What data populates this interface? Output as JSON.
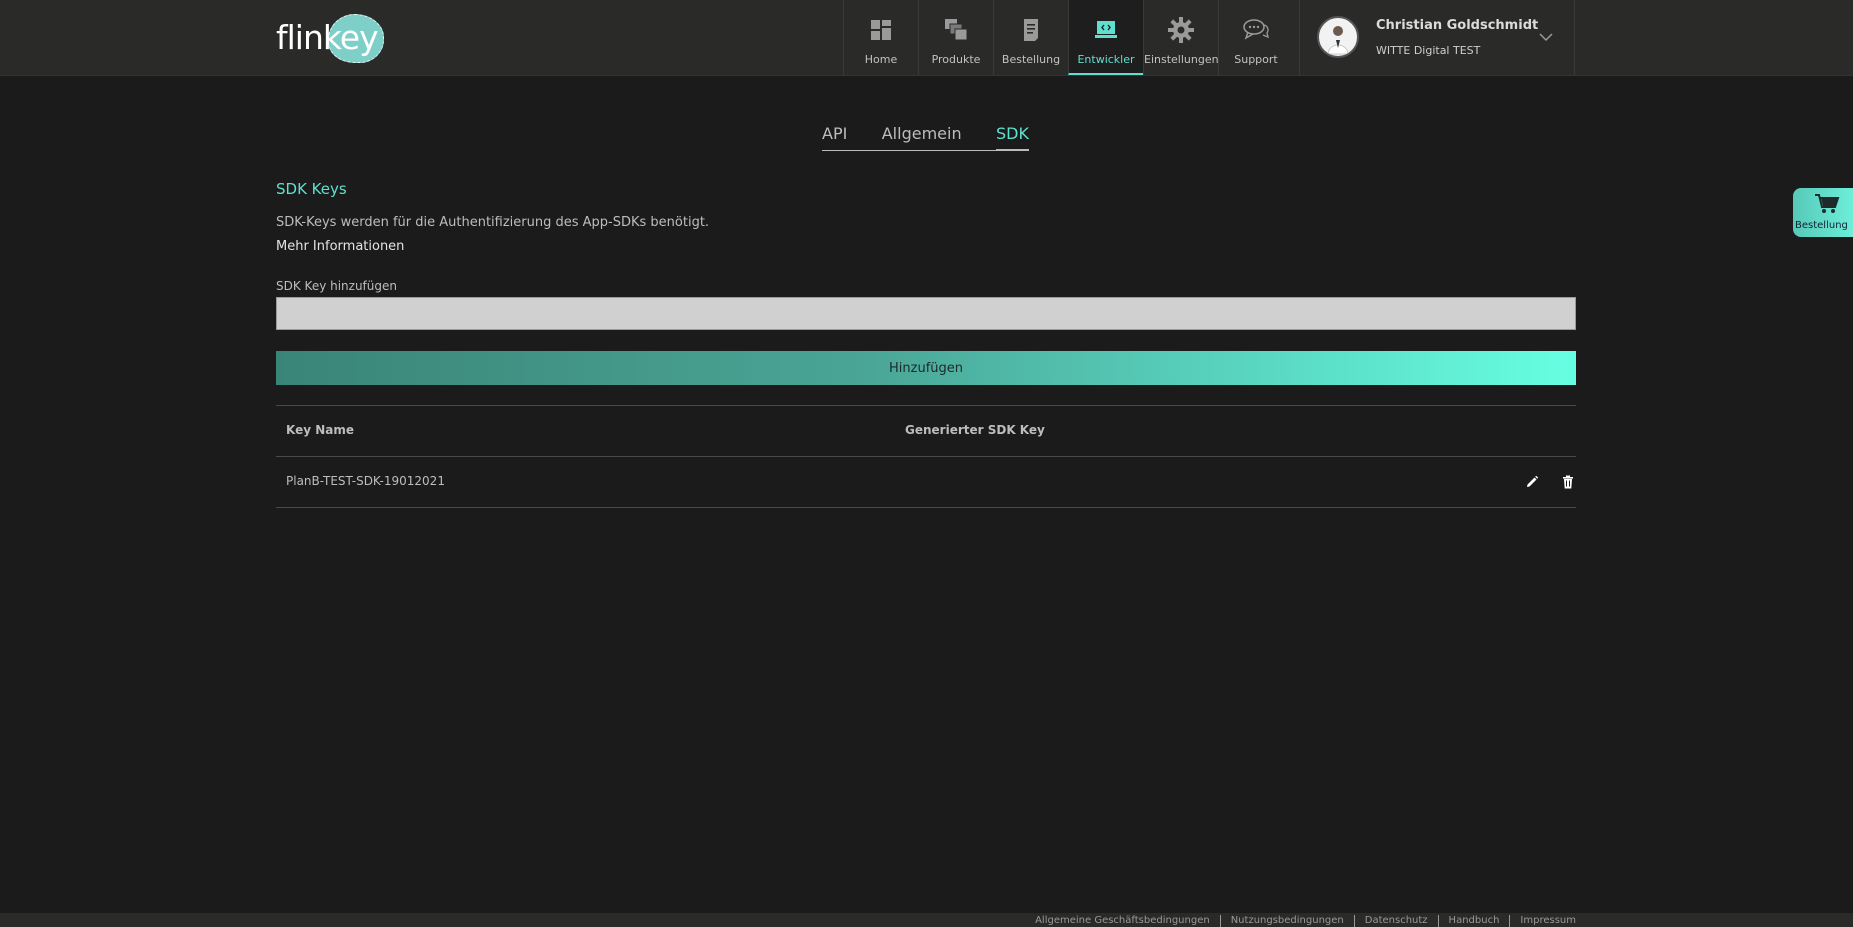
{
  "header": {
    "logo_text": "flinkey",
    "nav": [
      {
        "label": "Home",
        "icon": "dashboard-icon"
      },
      {
        "label": "Produkte",
        "icon": "products-icon"
      },
      {
        "label": "Bestellung",
        "icon": "order-icon"
      },
      {
        "label": "Entwickler",
        "icon": "developer-icon",
        "active": true
      },
      {
        "label": "Einstellungen",
        "icon": "gear-icon"
      },
      {
        "label": "Support",
        "icon": "chat-icon"
      }
    ],
    "user": {
      "name": "Christian Goldschmidt",
      "organization": "WITTE Digital TEST"
    }
  },
  "tabs": [
    {
      "label": "API"
    },
    {
      "label": "Allgemein"
    },
    {
      "label": "SDK",
      "active": true
    }
  ],
  "sdk": {
    "title": "SDK Keys",
    "description": "SDK-Keys werden für die Authentifizierung des App-SDKs benötigt.",
    "more_info": "Mehr Informationen",
    "input_label": "SDK Key hinzufügen",
    "input_value": "",
    "add_button": "Hinzufügen"
  },
  "table": {
    "columns": [
      "Key Name",
      "Generierter SDK Key"
    ],
    "rows": [
      {
        "key_name": "PlanB-TEST-SDK-19012021",
        "generated_key": ""
      }
    ]
  },
  "side_cart": {
    "label": "Bestellung"
  },
  "footer": {
    "links": [
      "Allgemeine Geschäftsbedingungen",
      "Nutzungsbedingungen",
      "Datenschutz",
      "Handbuch",
      "Impressum"
    ]
  },
  "colors": {
    "accent": "#5fe0cf",
    "background": "#1b1b1b",
    "header": "#2a2a29"
  }
}
